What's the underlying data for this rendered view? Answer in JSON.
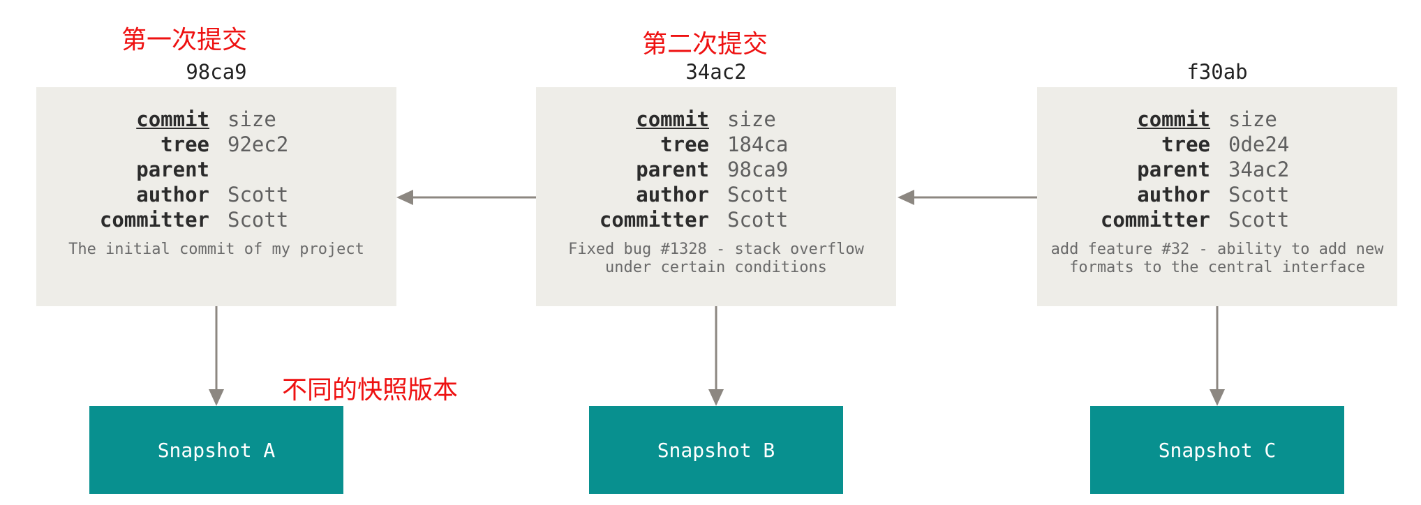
{
  "annotations": {
    "first_commit": "第一次提交",
    "second_commit": "第二次提交",
    "snapshots_note": "不同的快照版本"
  },
  "commits": [
    {
      "hash": "98ca9",
      "rows": [
        {
          "key": "commit",
          "value": "size"
        },
        {
          "key": "tree",
          "value": "92ec2"
        },
        {
          "key": "parent",
          "value": ""
        },
        {
          "key": "author",
          "value": "Scott"
        },
        {
          "key": "committer",
          "value": "Scott"
        }
      ],
      "message": "The initial commit of my project",
      "snapshot": "Snapshot A"
    },
    {
      "hash": "34ac2",
      "rows": [
        {
          "key": "commit",
          "value": "size"
        },
        {
          "key": "tree",
          "value": "184ca"
        },
        {
          "key": "parent",
          "value": "98ca9"
        },
        {
          "key": "author",
          "value": "Scott"
        },
        {
          "key": "committer",
          "value": "Scott"
        }
      ],
      "message": "Fixed bug #1328 - stack overflow\nunder certain conditions",
      "snapshot": "Snapshot B"
    },
    {
      "hash": "f30ab",
      "rows": [
        {
          "key": "commit",
          "value": "size"
        },
        {
          "key": "tree",
          "value": "0de24"
        },
        {
          "key": "parent",
          "value": "34ac2"
        },
        {
          "key": "author",
          "value": "Scott"
        },
        {
          "key": "committer",
          "value": "Scott"
        }
      ],
      "message": "add feature #32 - ability to add new\nformats to the central interface",
      "snapshot": "Snapshot C"
    }
  ],
  "colors": {
    "box_background": "#eeede8",
    "snapshot_background": "#08908f",
    "arrow": "#8c8781",
    "annotation_red": "#ee1111"
  }
}
